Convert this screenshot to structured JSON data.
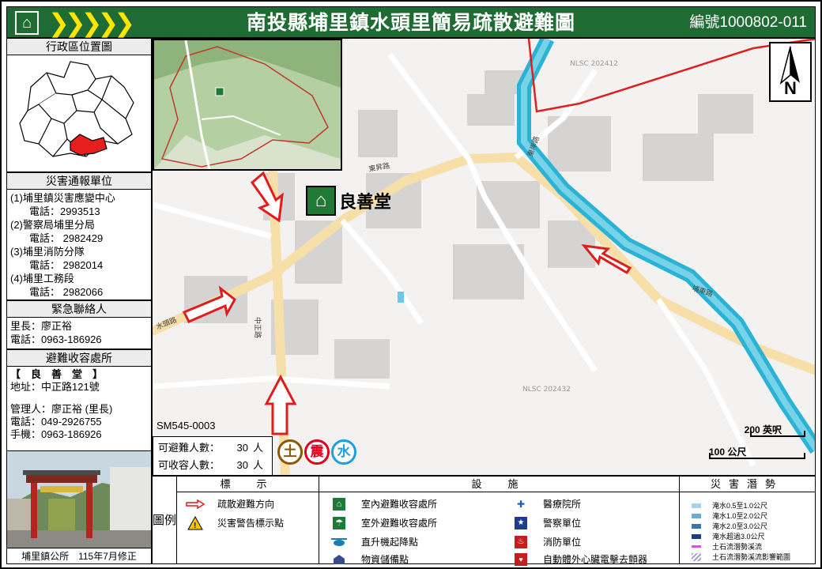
{
  "header": {
    "logo_icon": "shelter-exit-icon",
    "chevrons": "❯❯❯❯❯",
    "title": "南投縣埔里鎮水頭里簡易疏散避難圖",
    "code": "編號1000802-011"
  },
  "location_map": {
    "title": "行政區位置圖"
  },
  "reporting": {
    "title": "災害通報單位",
    "units": [
      {
        "name": "(1)埔里鎮災害應變中心",
        "phone": "電話：2993513"
      },
      {
        "name": "(2)警察局埔里分局",
        "phone": "電話： 2982429"
      },
      {
        "name": "(3)埔里消防分隊",
        "phone": "電話： 2982014"
      },
      {
        "name": "(4)埔里工務段",
        "phone": "電話： 2982066"
      }
    ]
  },
  "emergency": {
    "title": "緊急聯絡人",
    "chief": "里長：廖正裕",
    "phone": "電話：0963-186926"
  },
  "shelter_info": {
    "title": "避難收容處所",
    "name": "【　良　善　堂　】",
    "address": "地址：中正路121號",
    "manager": "管理人：廖正裕 (里長)",
    "phone": "電話：049-2926755",
    "mobile": "手機：0963-186926"
  },
  "credit": "埔里鎮公所　115年7月修正",
  "map": {
    "shelter_label": "良善堂",
    "sm_code": "SM545-0003",
    "evacuees_label": "可避難人數：",
    "evacuees_value": "30",
    "capacity_label": "可收容人數：",
    "capacity_value": "30",
    "unit": "人",
    "hazards": [
      {
        "label": "土",
        "color": "#8b5a00"
      },
      {
        "label": "震",
        "color": "#e0001b"
      },
      {
        "label": "水",
        "color": "#1e9ee0"
      }
    ],
    "compass_label": "N",
    "scale_top": "200 英呎",
    "scale_bottom": "100 公尺",
    "road_labels": [
      "中正路",
      "水頭路",
      "東昇路",
      "東岸路",
      "埔東路",
      "NLSC 202432",
      "NLSC 202412"
    ]
  },
  "legend": {
    "side_title": "圖例",
    "col1_title": "標　示",
    "col2_title": "設　施",
    "col3_title": "災害潛勢",
    "markers": [
      {
        "label": "疏散避難方向",
        "icon": "evacuation-arrow-icon"
      },
      {
        "label": "災害警告標示點",
        "icon": "warning-triangle-icon"
      }
    ],
    "facilities_left": [
      {
        "label": "室內避難收容處所",
        "icon": "indoor-shelter-icon"
      },
      {
        "label": "室外避難收容處所",
        "icon": "outdoor-shelter-icon"
      },
      {
        "label": "直升機起降點",
        "icon": "helicopter-icon"
      },
      {
        "label": "物資儲備點",
        "icon": "supply-depot-icon"
      }
    ],
    "facilities_right": [
      {
        "label": "醫療院所",
        "icon": "medical-icon"
      },
      {
        "label": "警察單位",
        "icon": "police-icon"
      },
      {
        "label": "消防單位",
        "icon": "fire-dept-icon"
      },
      {
        "label": "自動體外心臟電擊去顫器",
        "icon": "aed-icon"
      }
    ],
    "potentials": [
      {
        "label": "淹水0.5至1.0公尺",
        "color": "#a9d3ea"
      },
      {
        "label": "淹水1.0至2.0公尺",
        "color": "#6ea9d4"
      },
      {
        "label": "淹水2.0至3.0公尺",
        "color": "#3b73b0"
      },
      {
        "label": "淹水超過3.0公尺",
        "color": "#1c3f7a"
      },
      {
        "label": "土石流潛勢溪流",
        "color": "#c55fd6"
      },
      {
        "label": "土石流潛勢溪流影響範圍",
        "color": "#a5a0cf"
      }
    ]
  }
}
